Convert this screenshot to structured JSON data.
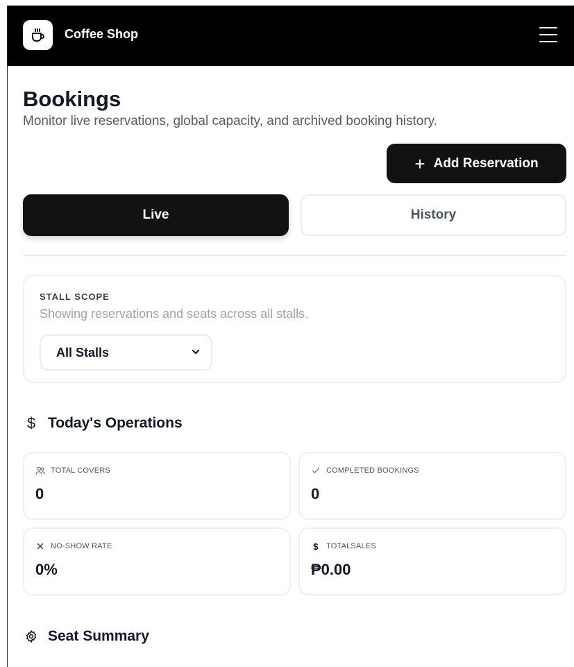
{
  "app": {
    "title": "Coffee Shop"
  },
  "header": {
    "title": "Bookings",
    "subtitle": "Monitor live reservations, global capacity, and archived booking history.",
    "add_button_label": "Add Reservation"
  },
  "tabs": [
    {
      "label": "Live",
      "active": true
    },
    {
      "label": "History",
      "active": false
    }
  ],
  "stall_scope": {
    "title": "STALL SCOPE",
    "description": "Showing reservations and seats across all stalls.",
    "selected": "All Stalls"
  },
  "operations": {
    "title": "Today's Operations",
    "icon": "dollar-icon",
    "stats": [
      {
        "label": "TOTAL COVERS",
        "value": "0",
        "icon": "users-icon"
      },
      {
        "label": "COMPLETED BOOKINGS",
        "value": "0",
        "icon": "check-icon"
      },
      {
        "label": "NO-SHOW RATE",
        "value": "0%",
        "icon": "x-icon"
      },
      {
        "label": "TOTALSALES",
        "value": "₱0.00",
        "icon": "dollar-icon"
      }
    ]
  },
  "seat_summary": {
    "title": "Seat Summary",
    "icon": "gear-icon"
  },
  "colors": {
    "primary": "#111111",
    "header_bg": "#000000",
    "card_border": "#f0f0f0",
    "muted_text": "#9ca3af"
  }
}
